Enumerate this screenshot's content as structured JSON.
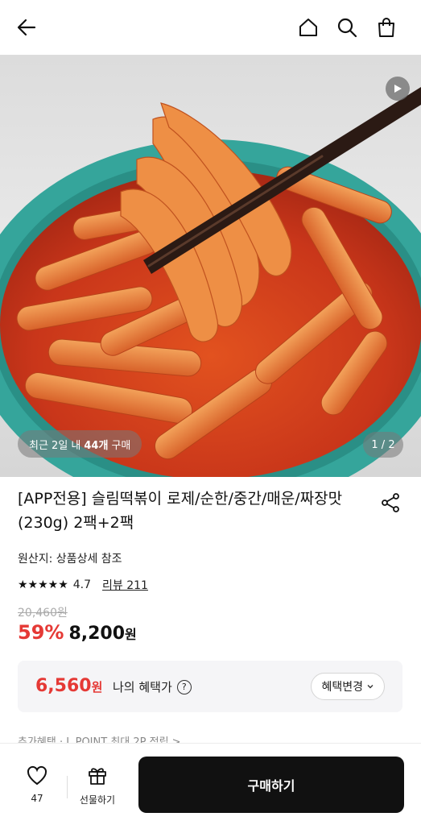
{
  "header": {
    "back_icon": "arrow-left-icon",
    "home_icon": "home-icon",
    "search_icon": "search-icon",
    "cart_icon": "shopping-bag-icon"
  },
  "hero": {
    "recent_prefix": "최근 2일 내",
    "recent_count": "44개",
    "recent_suffix": "구매",
    "page_indicator": "1 / 2",
    "play_icon": "play-icon"
  },
  "product": {
    "title": "[APP전용] 슬림떡볶이 로제/순한/중간/매운/짜장맛(230g) 2팩+2팩",
    "origin": "원산지: 상품상세 참조",
    "rating": {
      "stars": 4.7,
      "score": "4.7",
      "reviews_label": "리뷰 211"
    },
    "original_price": "20,460원",
    "discount": "59%",
    "price": "8,200",
    "price_unit": "원"
  },
  "benefit": {
    "price": "6,560",
    "price_unit": "원",
    "label": "나의 혜택가",
    "change_label": "혜택변경"
  },
  "peek_text": "추가혜택 · L.POINT 최대 2P 적립 >",
  "bottom": {
    "wish_count": "47",
    "gift_label": "선물하기",
    "buy_label": "구매하기"
  },
  "colors": {
    "accent": "#e53935",
    "buy_button": "#111111"
  }
}
